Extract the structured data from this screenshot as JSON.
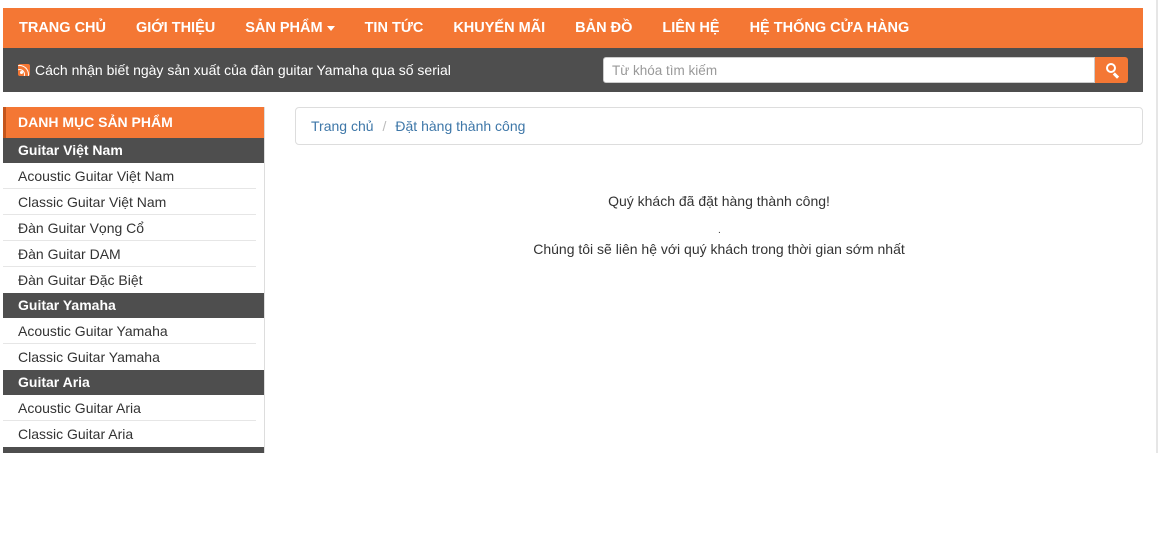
{
  "nav": {
    "items": [
      {
        "label": "TRANG CHỦ"
      },
      {
        "label": "GIỚI THIỆU"
      },
      {
        "label": "SẢN PHẨM",
        "has_dropdown": true
      },
      {
        "label": "TIN TỨC"
      },
      {
        "label": "KHUYẾN MÃI"
      },
      {
        "label": "BẢN ĐỒ"
      },
      {
        "label": "LIÊN HỆ"
      },
      {
        "label": "HỆ THỐNG CỬA HÀNG"
      }
    ]
  },
  "ticker": {
    "icon": "rss-icon",
    "text": "Cách nhận biết ngày sản xuất của đàn guitar Yamaha qua số serial"
  },
  "search": {
    "placeholder": "Từ khóa tìm kiếm",
    "value": "",
    "button_icon": "search-icon"
  },
  "sidebar": {
    "title": "DANH MỤC SẢN PHẨM",
    "groups": [
      {
        "header": "Guitar Việt Nam",
        "items": [
          "Acoustic Guitar Việt Nam",
          "Classic Guitar Việt Nam",
          "Đàn Guitar Vọng Cổ",
          "Đàn Guitar DAM",
          "Đàn Guitar Đặc Biệt"
        ]
      },
      {
        "header": "Guitar Yamaha",
        "items": [
          "Acoustic Guitar Yamaha",
          "Classic Guitar Yamaha"
        ]
      },
      {
        "header": "Guitar Aria",
        "items": [
          "Acoustic Guitar Aria",
          "Classic Guitar Aria"
        ]
      }
    ]
  },
  "breadcrumb": {
    "items": [
      "Trang chủ",
      "Đặt hàng thành công"
    ],
    "separator": "/"
  },
  "message": {
    "line1": "Quý khách đã đặt hàng thành công!",
    "dot": ".",
    "line2": "Chúng tôi sẽ liên hệ với quý khách trong thời gian sớm nhất"
  },
  "colors": {
    "accent": "#f47734",
    "dark_bar": "#4e4e4e",
    "link": "#3e77a8"
  }
}
